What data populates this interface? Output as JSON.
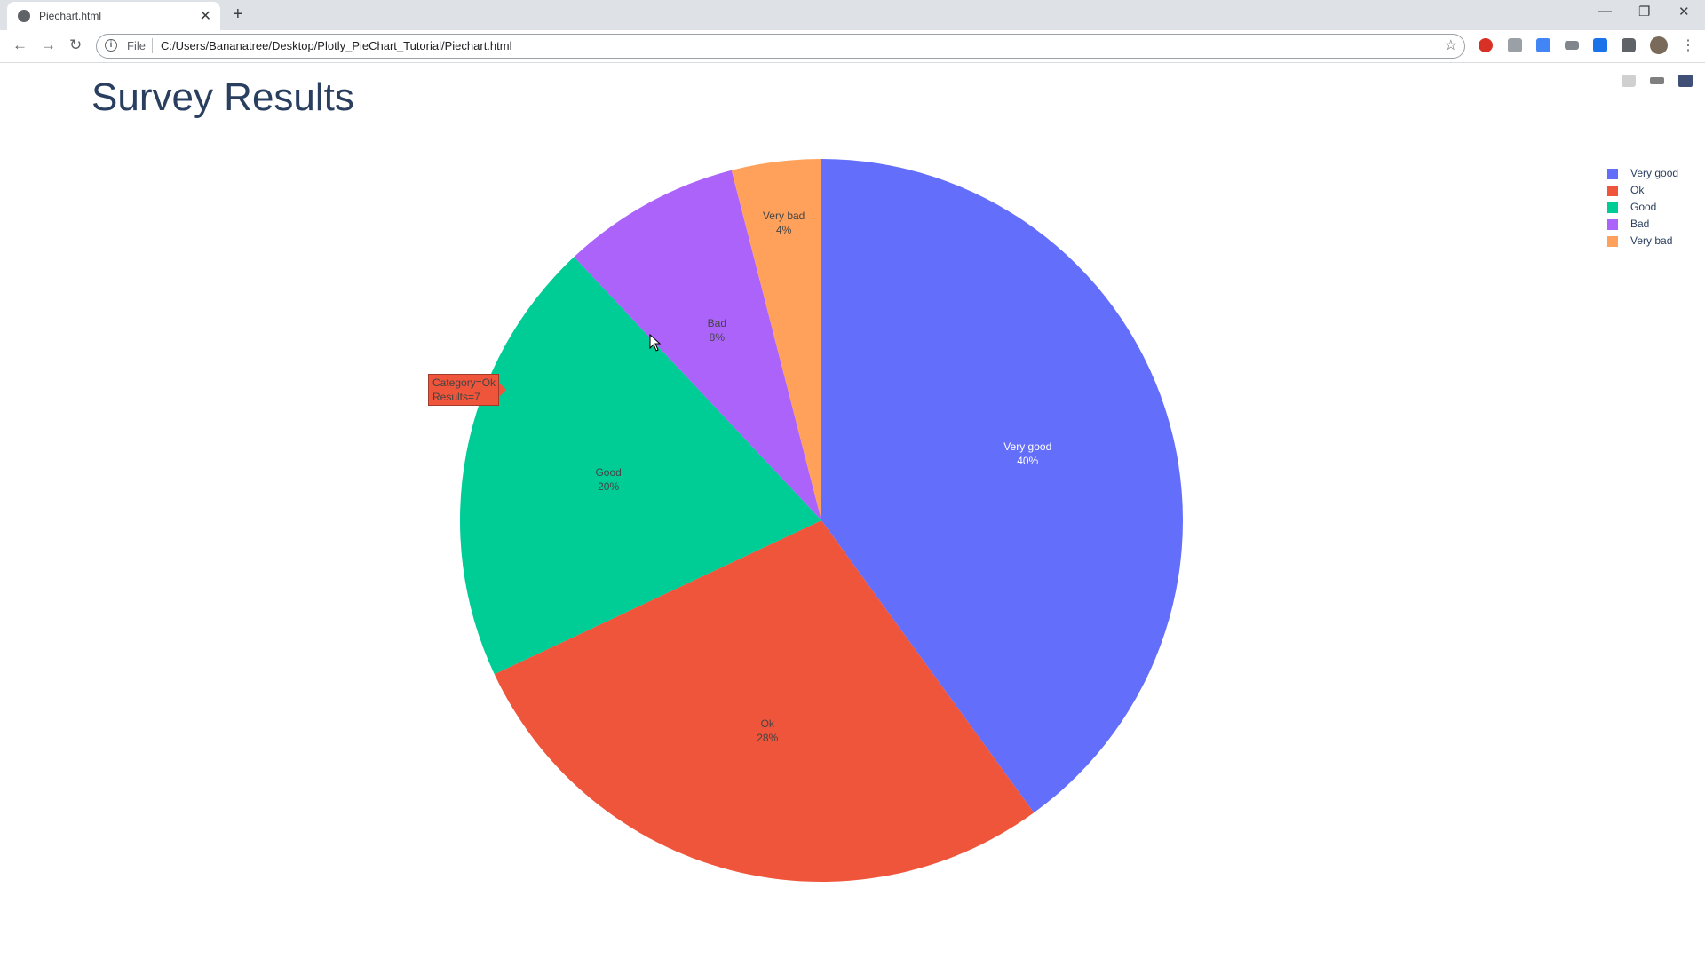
{
  "browser": {
    "tab_title": "Piechart.html",
    "scheme": "File",
    "url": "C:/Users/Bananatree/Desktop/Plotly_PieChart_Tutorial/Piechart.html"
  },
  "page": {
    "title": "Survey Results"
  },
  "tooltip": {
    "line1": "Category=Ok",
    "line2": "Results=7"
  },
  "chart_data": {
    "type": "pie",
    "title": "Survey Results",
    "categories": [
      "Very good",
      "Ok",
      "Good",
      "Bad",
      "Very bad"
    ],
    "values": [
      10,
      7,
      5,
      2,
      1
    ],
    "percent_labels": [
      "40%",
      "28%",
      "20%",
      "8%",
      "4%"
    ],
    "colors": [
      "#636efa",
      "#ef553b",
      "#00cc96",
      "#ab63fa",
      "#ffa15a"
    ],
    "legend_position": "top-right",
    "slice_text_colors": [
      "#ffffff",
      "#444444",
      "#444444",
      "#444444",
      "#444444"
    ]
  }
}
